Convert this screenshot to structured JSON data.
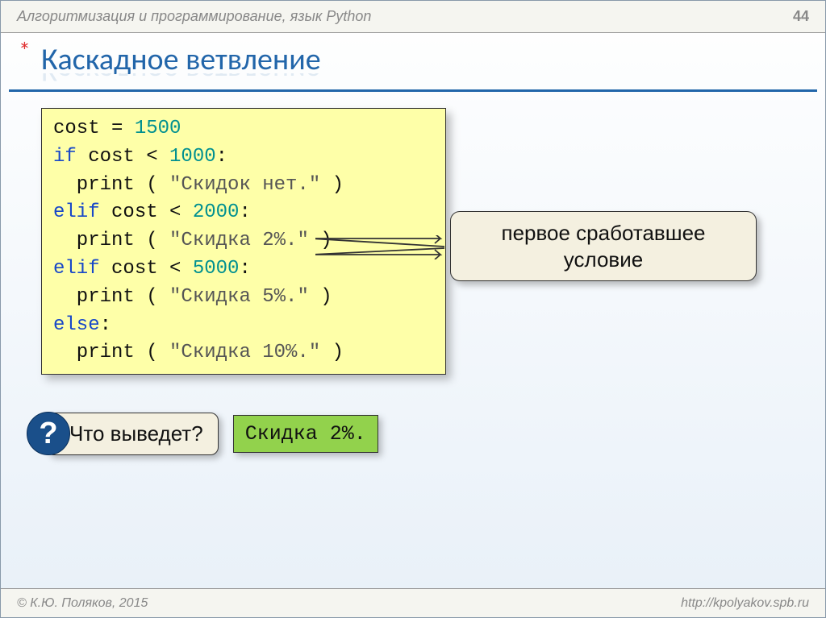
{
  "header": {
    "subject": "Алгоритмизация и программирование, язык Python",
    "page_number": "44"
  },
  "title": {
    "star": "*",
    "text": "Каскадное ветвление"
  },
  "code": {
    "l1_a": "cost = ",
    "l1_num": "1500",
    "l2_kw": "if",
    "l2_a": " cost < ",
    "l2_num": "1000",
    "l2_colon": ":",
    "l3_a": "  print ( ",
    "l3_str": "\"Скидок нет.\"",
    "l3_b": " )",
    "l4_kw": "elif",
    "l4_a": " cost < ",
    "l4_num": "2000",
    "l4_colon": ":",
    "l5_a": "  print ( ",
    "l5_str": "\"Скидка 2%.\"",
    "l5_b": " )",
    "l6_kw": "elif",
    "l6_a": " cost < ",
    "l6_num": "5000",
    "l6_colon": ":",
    "l7_a": "  print ( ",
    "l7_str": "\"Скидка 5%.\"",
    "l7_b": " )",
    "l8_kw": "else",
    "l8_colon": ":",
    "l9_a": "  print ( ",
    "l9_str": "\"Скидка 10%.\"",
    "l9_b": " )"
  },
  "callout": {
    "line1": "первое сработавшее",
    "line2": "условие"
  },
  "question": {
    "badge": "?",
    "text": "Что выведет?",
    "answer": "Скидка 2%."
  },
  "footer": {
    "copyright": "© К.Ю. Поляков, 2015",
    "url": "http://kpolyakov.spb.ru"
  }
}
